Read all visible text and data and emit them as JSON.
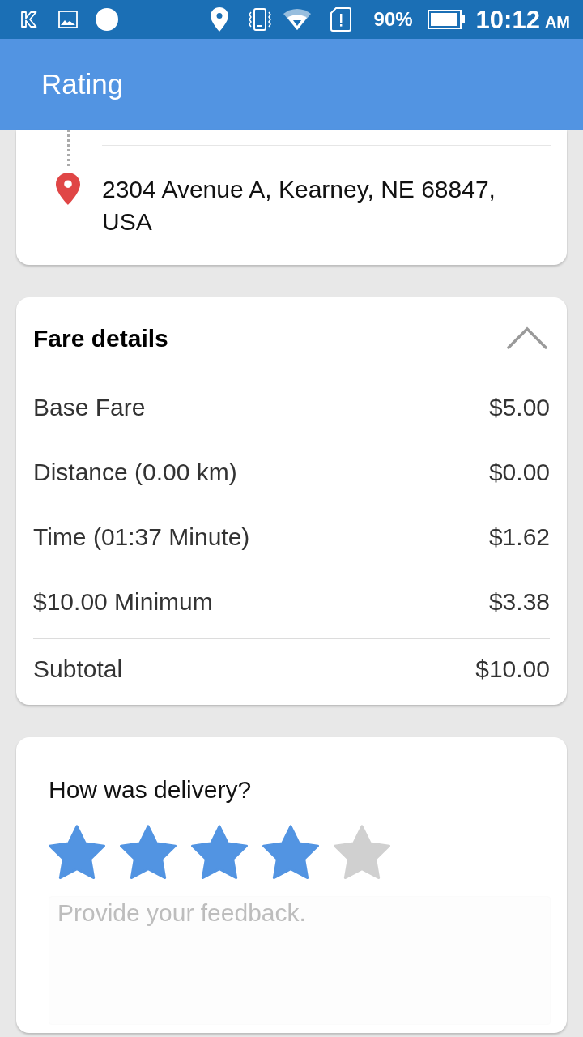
{
  "status_bar": {
    "battery": "90%",
    "time": "10:12",
    "meridiem": "AM"
  },
  "app_bar": {
    "title": "Rating"
  },
  "route": {
    "dropoff": "2304 Avenue A, Kearney, NE 68847, USA"
  },
  "fare_details": {
    "title": "Fare details",
    "expanded": true,
    "rows": [
      {
        "label": "Base Fare",
        "amount": "$5.00"
      },
      {
        "label": "Distance (0.00 km)",
        "amount": "$0.00"
      },
      {
        "label": "Time (01:37 Minute)",
        "amount": "$1.62"
      },
      {
        "label": "$10.00 Minimum",
        "amount": "$3.38"
      }
    ],
    "subtotal": {
      "label": "Subtotal",
      "amount": "$10.00"
    }
  },
  "rating": {
    "question": "How was delivery?",
    "stars": 4,
    "feedback": {
      "placeholder": "Provide your feedback."
    }
  }
}
